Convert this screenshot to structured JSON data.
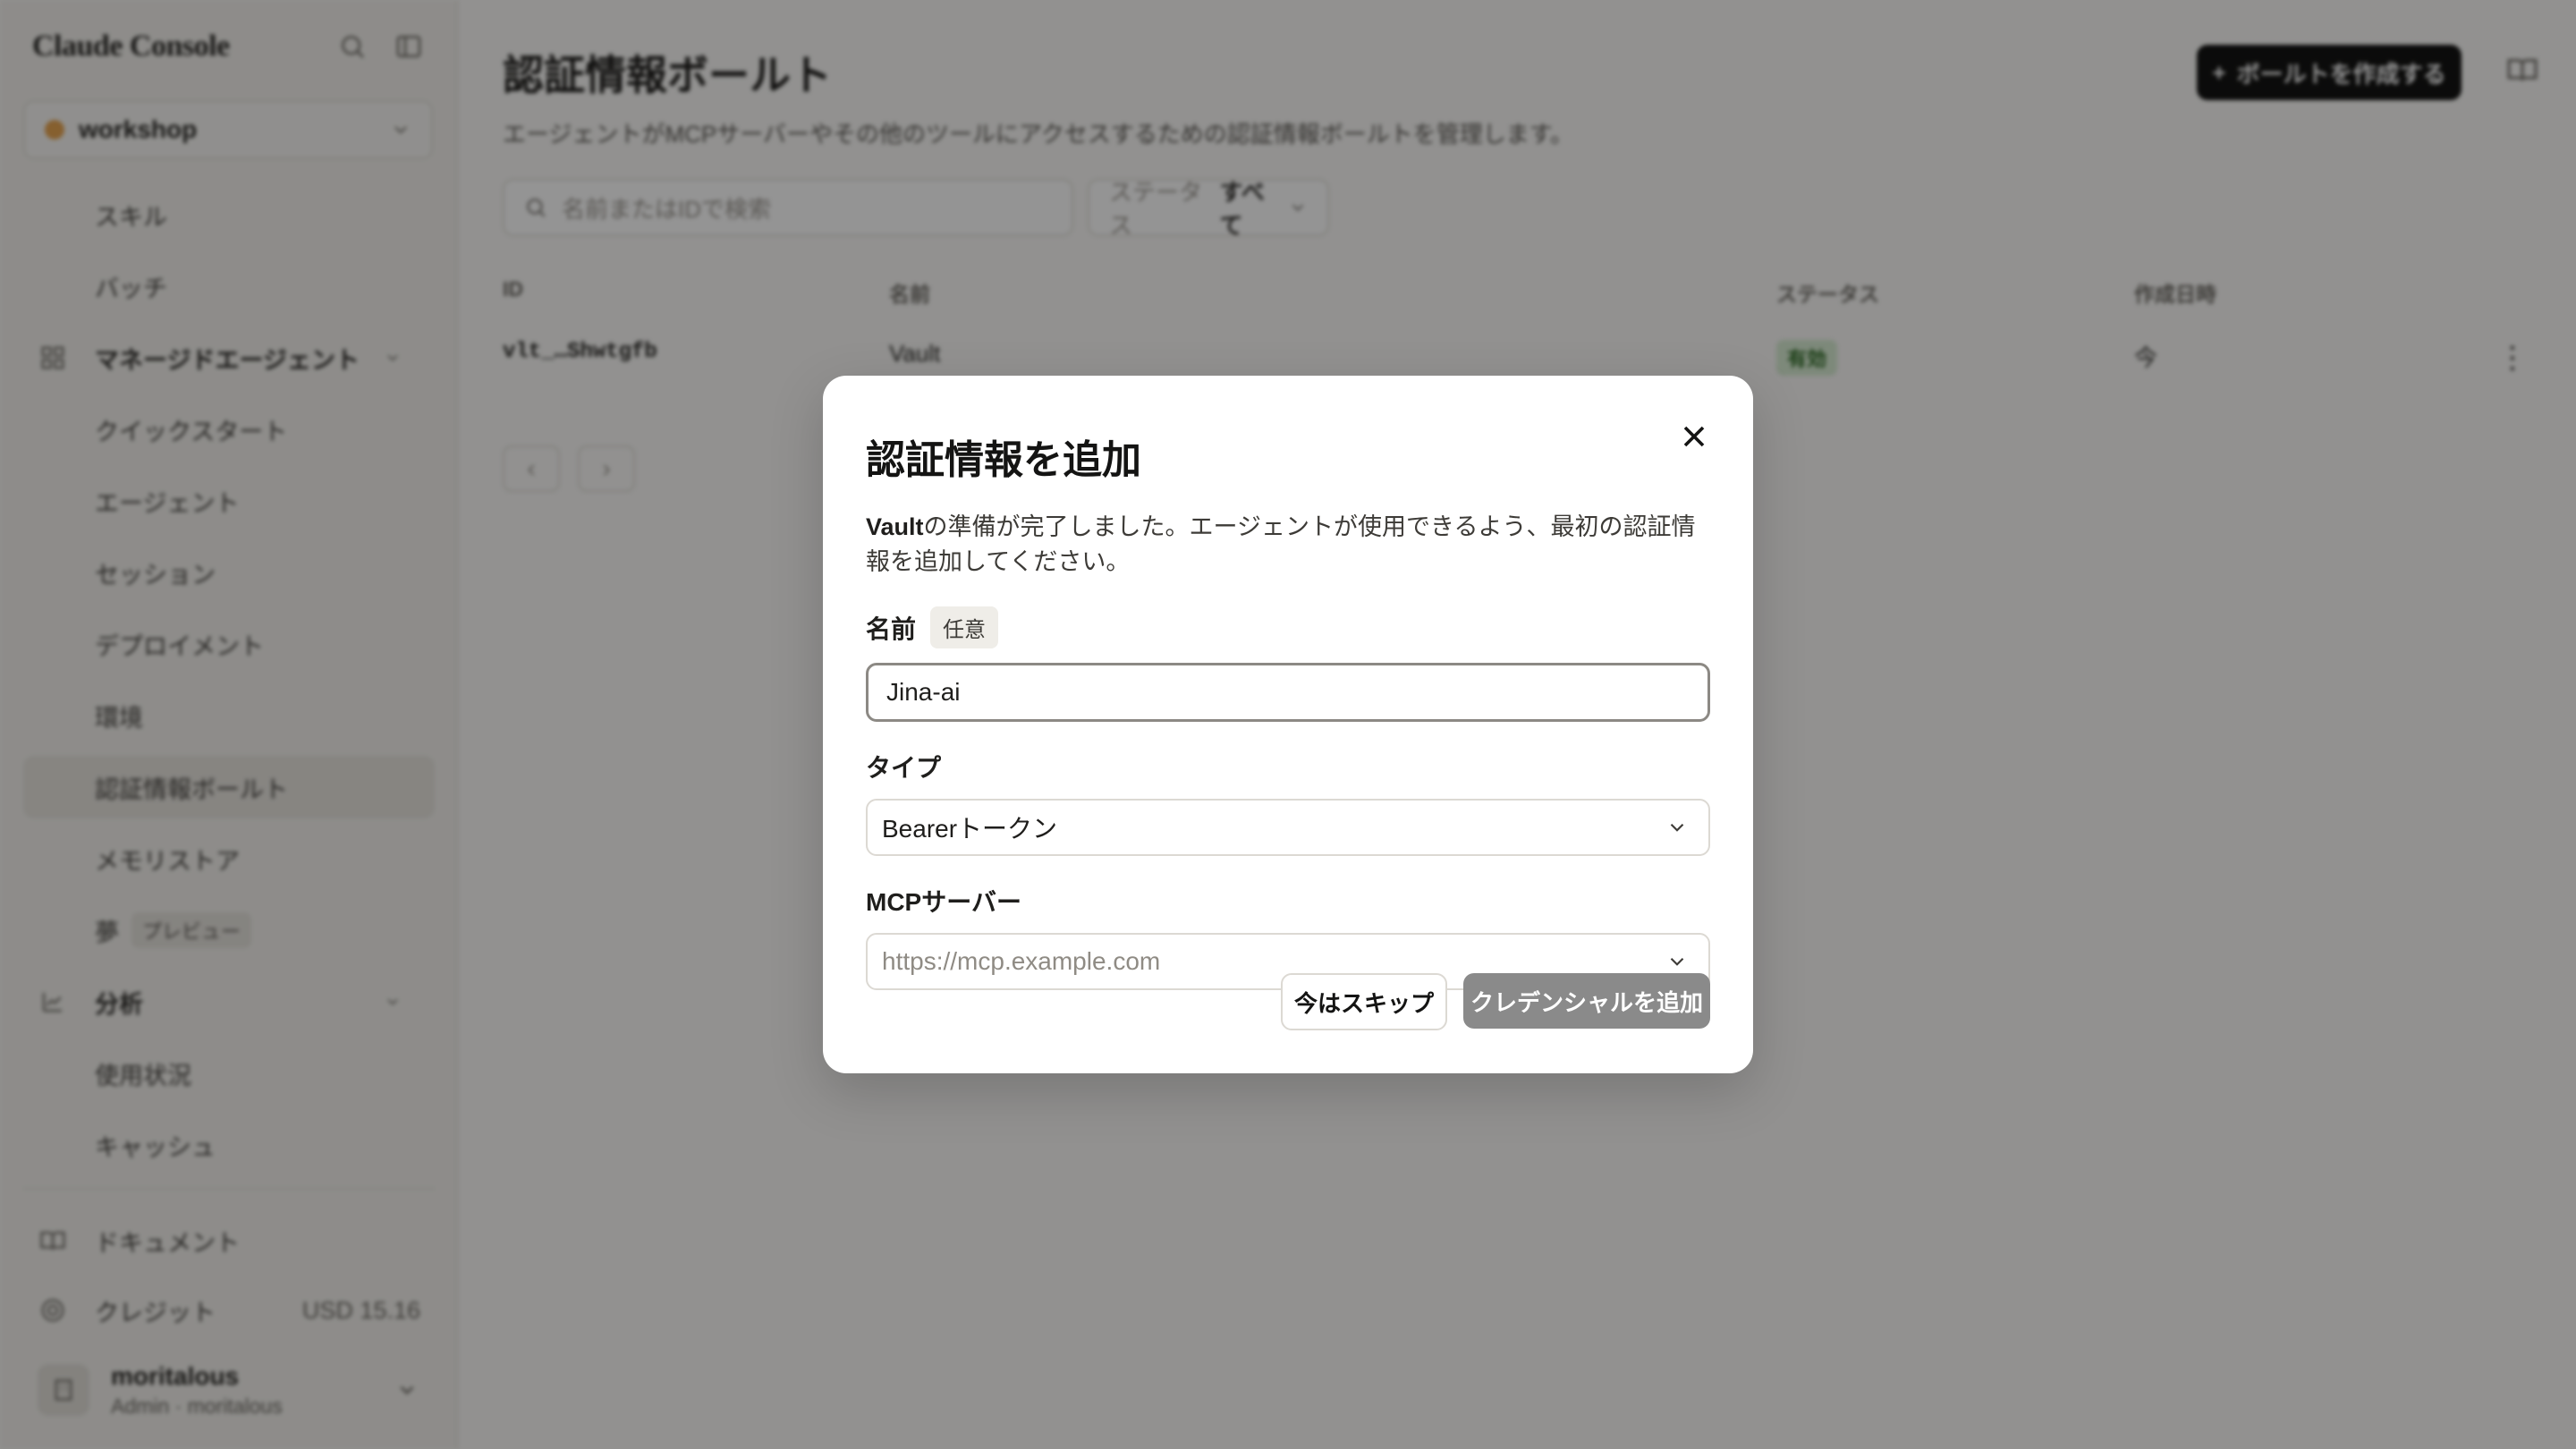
{
  "sidebar": {
    "brand": "Claude Console",
    "workspace": "workshop",
    "nav": {
      "skills": "スキル",
      "batch": "バッチ",
      "managed_agents": "マネージドエージェント",
      "quickstart": "クイックスタート",
      "agents": "エージェント",
      "sessions": "セッション",
      "deployments": "デプロイメント",
      "environments": "環境",
      "vaults": "認証情報ボールト",
      "memory_stores": "メモリストア",
      "dreams": "夢",
      "preview_tag": "プレビュー",
      "analytics": "分析",
      "usage": "使用状況",
      "cache": "キャッシュ"
    },
    "docs": "ドキュメント",
    "credits": "クレジット",
    "credits_value": "USD 15.16",
    "user": {
      "name": "moritalous",
      "role": "Admin · moritalous"
    }
  },
  "main": {
    "title": "認証情報ボールト",
    "subtitle": "エージェントがMCPサーバーやその他のツールにアクセスするための認証情報ボールトを管理します。",
    "create_button": "ボールトを作成する",
    "search_placeholder": "名前またはIDで検索",
    "status_filter_label": "ステータス",
    "status_filter_value": "すべて",
    "table": {
      "headers": [
        "ID",
        "名前",
        "ステータス",
        "作成日時"
      ],
      "rows": [
        {
          "id": "vlt_…Shwtgfb",
          "name": "Vault",
          "status": "有効",
          "created": "今"
        }
      ]
    }
  },
  "modal": {
    "title": "認証情報を追加",
    "desc_bold": "Vault",
    "desc_rest": "の準備が完了しました。エージェントが使用できるよう、最初の認証情報を追加してください。",
    "name_label": "名前",
    "optional_tag": "任意",
    "name_value": "Jina-ai",
    "type_label": "タイプ",
    "type_value": "Bearerトークン",
    "mcp_label": "MCPサーバー",
    "mcp_placeholder": "https://mcp.example.com",
    "skip_button": "今はスキップ",
    "add_button": "クレデンシャルを追加"
  }
}
